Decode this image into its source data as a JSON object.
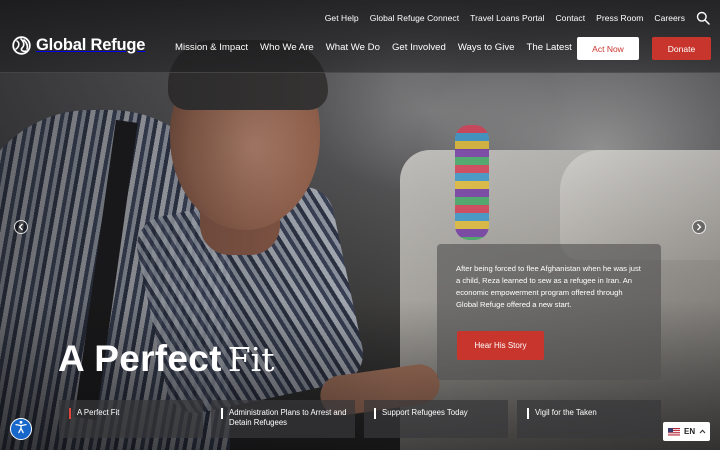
{
  "header": {
    "utility_links": [
      {
        "label": "Get Help"
      },
      {
        "label": "Global Refuge Connect"
      },
      {
        "label": "Travel Loans Portal"
      },
      {
        "label": "Contact"
      },
      {
        "label": "Press Room"
      },
      {
        "label": "Careers"
      }
    ],
    "search_icon": "search-icon",
    "logo_text": "Global Refuge",
    "nav": [
      {
        "label": "Mission & Impact"
      },
      {
        "label": "Who We Are"
      },
      {
        "label": "What We Do"
      },
      {
        "label": "Get Involved"
      },
      {
        "label": "Ways to Give"
      },
      {
        "label": "The Latest"
      }
    ],
    "act_now_label": "Act Now",
    "donate_label": "Donate"
  },
  "hero": {
    "title_bold": "A Perfect",
    "title_light": "Fit",
    "story_text": "After being forced to flee Afghanistan when he was just a child, Reza learned to sew as a refugee in Iran. An economic empowerment program offered through Global Refuge offered a new start.",
    "story_button": "Hear His Story",
    "prev_icon": "chevron-left-icon",
    "next_icon": "chevron-right-icon"
  },
  "slides": [
    {
      "label": "A Perfect Fit",
      "active": true
    },
    {
      "label": "Administration Plans to Arrest and Detain Refugees",
      "active": false
    },
    {
      "label": "Support Refugees Today",
      "active": false
    },
    {
      "label": "Vigil for the Taken",
      "active": false
    }
  ],
  "language": {
    "code": "EN",
    "flag_icon": "us-flag-icon"
  },
  "colors": {
    "accent_red": "#c8352d",
    "a11y_blue": "#1667c9"
  }
}
